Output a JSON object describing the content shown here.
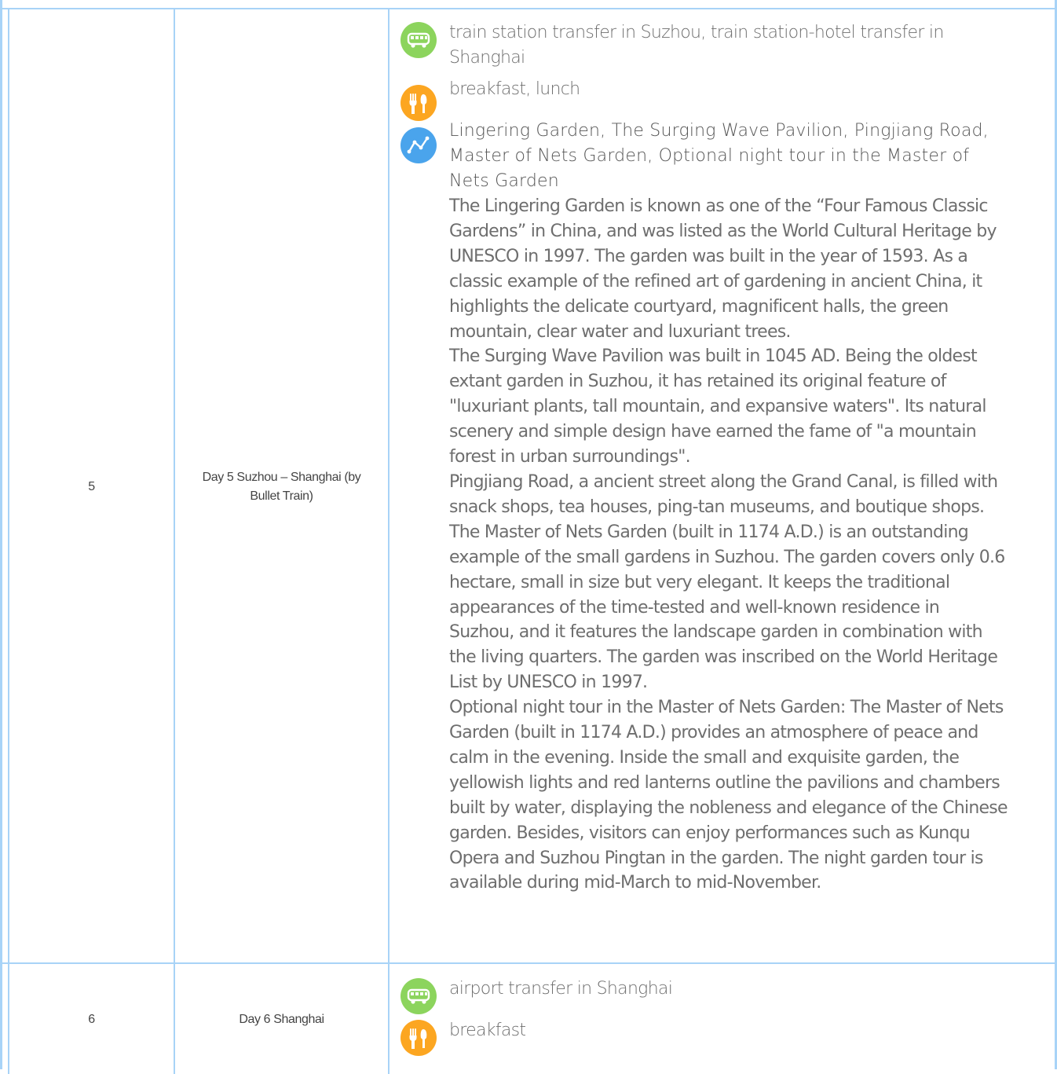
{
  "rows": [
    {
      "day": "5",
      "title": "Day 5 Suzhou – Shanghai (by Bullet Train)",
      "transfer": "train station transfer in Suzhou, train station-hotel transfer in Shanghai",
      "meals": "breakfast, lunch",
      "sights_heading": "Lingering Garden, The Surging Wave Pavilion, Pingjiang Road, Master of Nets Garden, Optional night tour in the Master of Nets Garden",
      "paragraphs": [
        "The Lingering Garden is known as one of the “Four Famous Classic Gardens” in China, and was listed as the World Cultural Heritage by UNESCO in 1997. The garden was built in the year of 1593. As a classic example of the refined art of gardening in ancient China, it highlights the delicate courtyard, magnificent halls, the green mountain, clear water and luxuriant trees.",
        "The Surging Wave Pavilion was built in 1045 AD. Being the oldest extant garden in Suzhou, it has retained its original feature of \"luxuriant plants, tall mountain, and expansive waters\". Its natural scenery and simple design have earned the fame of \"a mountain forest in urban surroundings\".",
        "Pingjiang Road, a ancient street along the Grand Canal, is filled with snack shops, tea houses, ping-tan museums, and boutique shops.",
        "The Master of Nets Garden (built in 1174 A.D.) is an outstanding example of the small gardens in Suzhou. The garden covers only 0.6 hectare, small in size but very elegant. It keeps the traditional appearances of the time-tested and well-known residence in Suzhou, and it features the landscape garden in combination with the living quarters. The garden was inscribed on the World Heritage List by UNESCO in 1997.",
        "Optional night tour in the Master of Nets Garden: The Master of Nets Garden (built in 1174 A.D.) provides an atmosphere of peace and calm in the evening. Inside the small and exquisite garden, the yellowish lights and red lanterns outline the pavilions and chambers built by water, displaying the nobleness and elegance of the Chinese garden. Besides, visitors can enjoy performances such as Kunqu Opera and Suzhou Pingtan in the garden. The night garden tour is available during mid-March to mid-November."
      ]
    },
    {
      "day": "6",
      "title": "Day 6 Shanghai",
      "transfer": "airport transfer in Shanghai",
      "meals": "breakfast"
    }
  ],
  "icons": {
    "transfer": "bus-icon",
    "meals": "fork-knife-icon",
    "sights": "route-icon"
  },
  "colors": {
    "border": "#a8d3f7",
    "transfer_icon": "#8cd45d",
    "meals_icon": "#fca621",
    "sights_icon": "#4aa4ec"
  }
}
